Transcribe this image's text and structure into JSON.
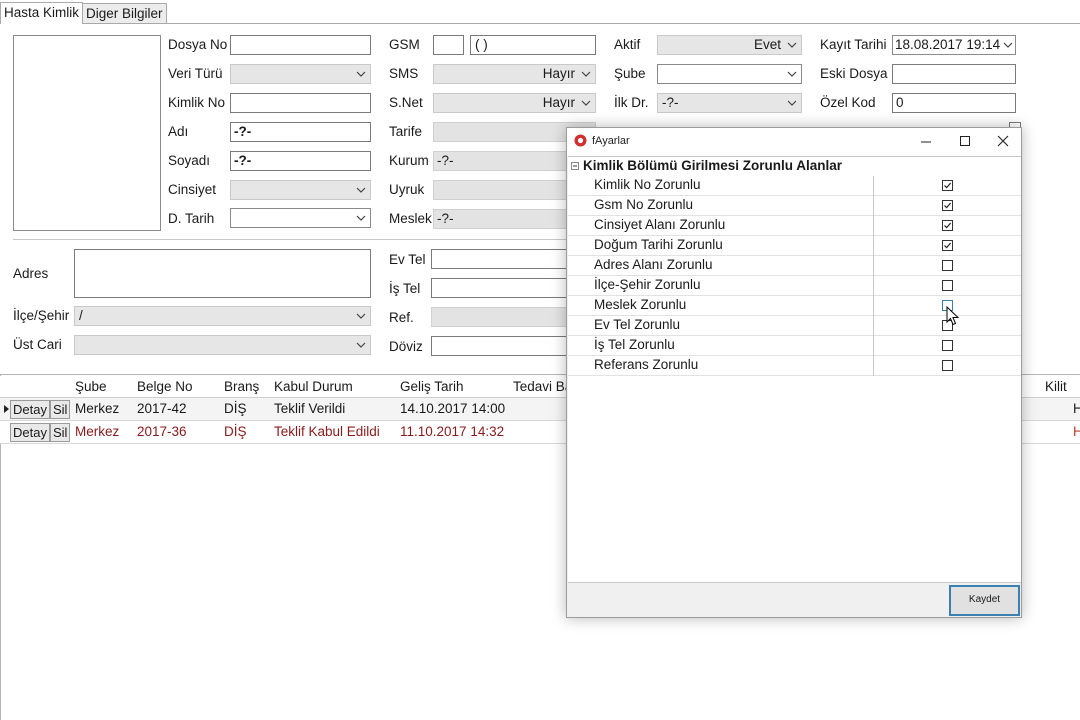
{
  "tabs": [
    "Hasta Kimlik",
    "Diger Bilgiler"
  ],
  "form": {
    "col1": {
      "dosya_no": {
        "label": "Dosya No",
        "value": ""
      },
      "veri_turu": {
        "label": "Veri Türü",
        "value": ""
      },
      "kimlik_no": {
        "label": "Kimlik No",
        "value": ""
      },
      "adi": {
        "label": "Adı",
        "value": "-?-"
      },
      "soyadi": {
        "label": "Soyadı",
        "value": "-?-"
      },
      "cinsiyet": {
        "label": "Cinsiyet",
        "value": ""
      },
      "d_tarih": {
        "label": "D. Tarih",
        "value": ""
      }
    },
    "col2": {
      "gsm": {
        "label": "GSM",
        "code": "",
        "value": "(   )"
      },
      "sms": {
        "label": "SMS",
        "value": "Hayır"
      },
      "snet": {
        "label": "S.Net",
        "value": "Hayır"
      },
      "tarife": {
        "label": "Tarife",
        "value": ""
      },
      "kurum": {
        "label": "Kurum",
        "value": "-?-"
      },
      "uyruk": {
        "label": "Uyruk",
        "value": ""
      },
      "meslek": {
        "label": "Meslek",
        "value": "-?-"
      }
    },
    "col3": {
      "aktif": {
        "label": "Aktif",
        "value": "Evet"
      },
      "sube": {
        "label": "Şube",
        "value": ""
      },
      "ilk_dr": {
        "label": "İlk Dr.",
        "value": "-?-"
      }
    },
    "col4": {
      "kayit_tarihi": {
        "label": "Kayıt Tarihi",
        "value": "18.08.2017 19:14"
      },
      "eski_dosya": {
        "label": "Eski Dosya",
        "value": ""
      },
      "ozel_kod": {
        "label": "Özel Kod",
        "value": "0"
      }
    },
    "address": {
      "adres": {
        "label": "Adres",
        "value": ""
      },
      "ilce_sehir": {
        "label": "İlçe/Şehir",
        "value": "/"
      },
      "ust_cari": {
        "label": "Üst Cari",
        "value": ""
      }
    },
    "phones": {
      "ev_tel": {
        "label": "Ev Tel",
        "value": ""
      },
      "is_tel": {
        "label": "İş Tel",
        "value": ""
      },
      "ref": {
        "label": "Ref.",
        "value": ""
      },
      "doviz": {
        "label": "Döviz",
        "value": ""
      }
    }
  },
  "grid": {
    "columns": [
      "Şube",
      "Belge No",
      "Branş",
      "Kabul Durum",
      "Geliş Tarih",
      "Tedavi Ba",
      "Kilit"
    ],
    "detay_label": "Detay",
    "sil_label": "Sil",
    "rows": [
      {
        "sube": "Merkez",
        "belge": "2017-42",
        "brans": "DİŞ",
        "durum": "Teklif Verildi",
        "tarih": "14.10.2017 14:00",
        "kilit": "H",
        "color": "#1a1a1a"
      },
      {
        "sube": "Merkez",
        "belge": "2017-36",
        "brans": "DİŞ",
        "durum": "Teklif Kabul Edildi",
        "tarih": "11.10.2017 14:32",
        "kilit": "H",
        "color": "#8b1a1a"
      }
    ]
  },
  "dialog": {
    "title": "fAyarlar",
    "section": "Kimlik Bölümü Girilmesi Zorunlu Alanlar",
    "items": [
      {
        "label": "Kimlik No Zorunlu",
        "checked": true
      },
      {
        "label": "Gsm No Zorunlu",
        "checked": true
      },
      {
        "label": "Cinsiyet Alanı Zorunlu",
        "checked": true
      },
      {
        "label": "Doğum Tarihi Zorunlu",
        "checked": true
      },
      {
        "label": "Adres Alanı Zorunlu",
        "checked": false
      },
      {
        "label": "İlçe-Şehir Zorunlu",
        "checked": false
      },
      {
        "label": "Meslek Zorunlu",
        "checked": false
      },
      {
        "label": "Ev Tel Zorunlu",
        "checked": false
      },
      {
        "label": "İş Tel Zorunlu",
        "checked": false
      },
      {
        "label": "Referans Zorunlu",
        "checked": false
      }
    ],
    "save_label": "Kaydet"
  },
  "colors": {
    "dialog_accent": "#d32f2f",
    "focus_border": "#3c7fb1"
  }
}
